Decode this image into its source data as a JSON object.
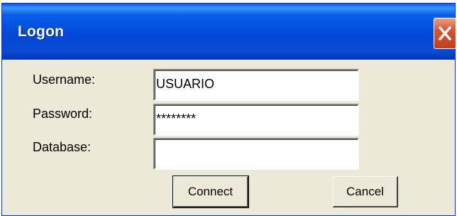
{
  "window": {
    "title": "Logon"
  },
  "form": {
    "username_label": "Username:",
    "username_value": "USUARIO",
    "password_label": "Password:",
    "password_value": "********",
    "database_label": "Database:",
    "database_value": ""
  },
  "buttons": {
    "connect_label": "Connect",
    "cancel_label": "Cancel"
  },
  "icons": {
    "close": "close-icon"
  },
  "colors": {
    "titlebar": "#0a4ad0",
    "close_button": "#d6532f",
    "dialog_bg": "#ece9d8"
  }
}
